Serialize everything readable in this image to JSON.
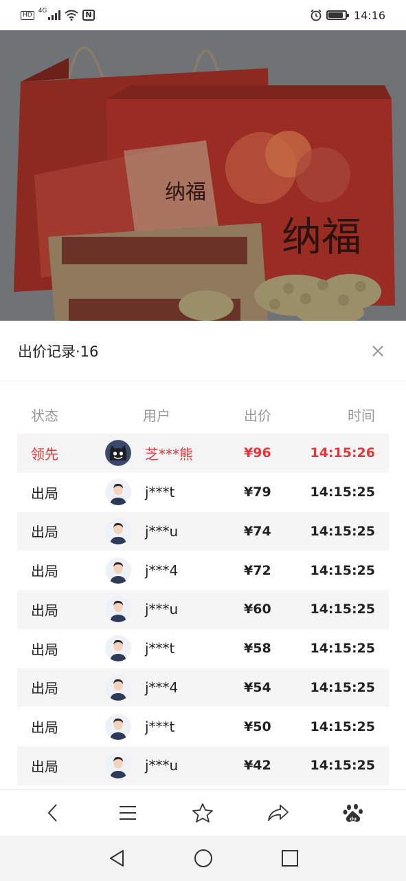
{
  "status_bar": {
    "hd": "HD",
    "net": "4G",
    "nfc": "N",
    "time": "14:16",
    "battery_level": 0.9
  },
  "sheet": {
    "title": "出价记录·16",
    "close_icon": "close-icon"
  },
  "table": {
    "headers": {
      "status": "状态",
      "user": "用户",
      "bid": "出价",
      "time": "时间"
    },
    "rows": [
      {
        "status": "领先",
        "user": "芝***熊",
        "bid": "¥96",
        "time": "14:15:26",
        "leader": true,
        "avatar": "dark-cat-avatar"
      },
      {
        "status": "出局",
        "user": "j***t",
        "bid": "¥79",
        "time": "14:15:25",
        "avatar": "default-user-avatar"
      },
      {
        "status": "出局",
        "user": "j***u",
        "bid": "¥74",
        "time": "14:15:25",
        "avatar": "default-user-avatar"
      },
      {
        "status": "出局",
        "user": "j***4",
        "bid": "¥72",
        "time": "14:15:25",
        "avatar": "default-user-avatar"
      },
      {
        "status": "出局",
        "user": "j***u",
        "bid": "¥60",
        "time": "14:15:25",
        "avatar": "default-user-avatar"
      },
      {
        "status": "出局",
        "user": "j***t",
        "bid": "¥58",
        "time": "14:15:25",
        "avatar": "default-user-avatar"
      },
      {
        "status": "出局",
        "user": "j***4",
        "bid": "¥54",
        "time": "14:15:25",
        "avatar": "default-user-avatar"
      },
      {
        "status": "出局",
        "user": "j***t",
        "bid": "¥50",
        "time": "14:15:25",
        "avatar": "default-user-avatar"
      },
      {
        "status": "出局",
        "user": "j***u",
        "bid": "¥42",
        "time": "14:15:25",
        "avatar": "default-user-avatar"
      }
    ]
  },
  "hero": {
    "brand_text": "纳福",
    "lid_text": "纳福"
  },
  "toolbar": {
    "items": [
      "back-icon",
      "menu-icon",
      "star-icon",
      "share-icon",
      "baidu-paw-icon"
    ]
  },
  "navbar": {
    "items": [
      "nav-back-icon",
      "home-icon",
      "recents-icon"
    ]
  },
  "colors": {
    "accent_red": "#e8353a",
    "row_alt": "#f5f5f5",
    "header_gray": "#999999"
  }
}
